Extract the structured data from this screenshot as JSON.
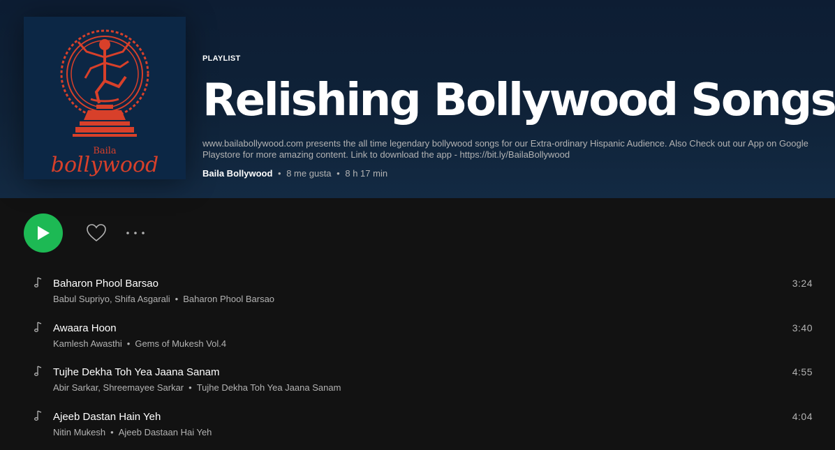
{
  "header": {
    "type_label": "PLAYLIST",
    "title": "Relishing Bollywood Songs",
    "description": "www.bailabollywood.com presents the all time legendary bollywood songs for our Extra-ordinary Hispanic Audience. Also Check out our App on Google Playstore for more amazing content. Link to download the app - https://bit.ly/BailaBollywood",
    "owner": "Baila Bollywood",
    "likes": "8 me gusta",
    "duration": "8 h 17 min",
    "separator": "•"
  },
  "cover": {
    "logo_small": "Baila",
    "logo_big": "bollywood",
    "background_color": "#0c2745",
    "art_color": "#d8402a"
  },
  "actions": {
    "play_icon": "play-icon",
    "like_icon": "heart-icon",
    "more_icon": "more-icon",
    "accent_color": "#1db954"
  },
  "tracks": [
    {
      "name": "Baharon Phool Barsao",
      "artists": "Babul Supriyo, Shifa Asgarali",
      "album": "Baharon Phool Barsao",
      "duration": "3:24"
    },
    {
      "name": "Awaara Hoon",
      "artists": "Kamlesh Awasthi",
      "album": "Gems of Mukesh Vol.4",
      "duration": "3:40"
    },
    {
      "name": "Tujhe Dekha Toh Yea Jaana Sanam",
      "artists": "Abir Sarkar, Shreemayee Sarkar",
      "album": "Tujhe Dekha Toh Yea Jaana Sanam",
      "duration": "4:55"
    },
    {
      "name": "Ajeeb Dastan Hain Yeh",
      "artists": "Nitin Mukesh",
      "album": "Ajeeb Dastaan Hai Yeh",
      "duration": "4:04"
    }
  ]
}
